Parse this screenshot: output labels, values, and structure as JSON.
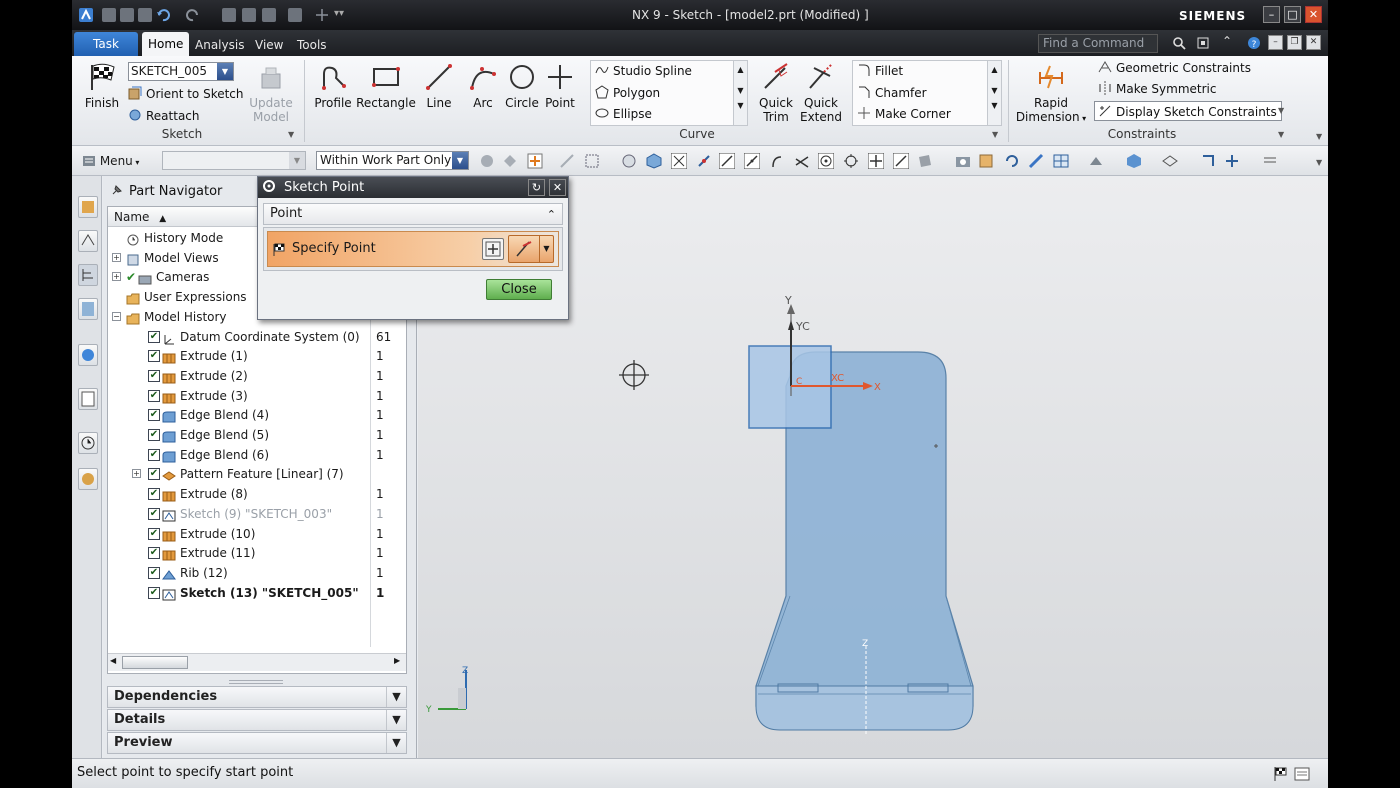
{
  "window": {
    "title": "NX 9 - Sketch - [model2.prt (Modified) ]",
    "brand": "SIEMENS"
  },
  "menu": {
    "task": "Task",
    "tabs": [
      "Home",
      "Analysis",
      "View",
      "Tools"
    ],
    "find_placeholder": "Find a Command"
  },
  "ribbon": {
    "sketch_group": {
      "finish": "Finish",
      "sketch_name": "SKETCH_005",
      "orient": "Orient to Sketch",
      "reattach": "Reattach",
      "update_model_line1": "Update",
      "update_model_line2": "Model",
      "label": "Sketch"
    },
    "curve_group": {
      "profile": "Profile",
      "rectangle": "Rectangle",
      "line": "Line",
      "arc": "Arc",
      "circle": "Circle",
      "point": "Point",
      "studio_spline": "Studio Spline",
      "polygon": "Polygon",
      "ellipse": "Ellipse",
      "quick_trim_l1": "Quick",
      "quick_trim_l2": "Trim",
      "quick_extend_l1": "Quick",
      "quick_extend_l2": "Extend",
      "fillet": "Fillet",
      "chamfer": "Chamfer",
      "make_corner": "Make Corner",
      "label": "Curve"
    },
    "constraints_group": {
      "rapid_dim_l1": "Rapid",
      "rapid_dim_l2": "Dimension",
      "geometric": "Geometric Constraints",
      "symmetric": "Make Symmetric",
      "display": "Display Sketch Constraints",
      "label": "Constraints"
    }
  },
  "toolbar": {
    "menu": "Menu",
    "filter": "Within Work Part Only"
  },
  "navigator": {
    "title": "Part Navigator",
    "column_name": "Name",
    "items": [
      {
        "label": "History Mode",
        "num": ""
      },
      {
        "label": "Model Views",
        "num": ""
      },
      {
        "label": "Cameras",
        "num": ""
      },
      {
        "label": "User Expressions",
        "num": ""
      },
      {
        "label": "Model History",
        "num": ""
      },
      {
        "label": "Datum Coordinate System (0)",
        "num": "61"
      },
      {
        "label": "Extrude (1)",
        "num": "1"
      },
      {
        "label": "Extrude (2)",
        "num": "1"
      },
      {
        "label": "Extrude (3)",
        "num": "1"
      },
      {
        "label": "Edge Blend (4)",
        "num": "1"
      },
      {
        "label": "Edge Blend (5)",
        "num": "1"
      },
      {
        "label": "Edge Blend (6)",
        "num": "1"
      },
      {
        "label": "Pattern Feature [Linear] (7)",
        "num": ""
      },
      {
        "label": "Extrude (8)",
        "num": "1"
      },
      {
        "label": "Sketch (9) \"SKETCH_003\"",
        "num": "1"
      },
      {
        "label": "Extrude (10)",
        "num": "1"
      },
      {
        "label": "Extrude (11)",
        "num": "1"
      },
      {
        "label": "Rib (12)",
        "num": "1"
      },
      {
        "label": "Sketch (13) \"SKETCH_005\"",
        "num": "1"
      }
    ],
    "accordions": [
      "Dependencies",
      "Details",
      "Preview"
    ]
  },
  "dialog": {
    "title": "Sketch Point",
    "section": "Point",
    "specify": "Specify Point",
    "close": "Close"
  },
  "graphics": {
    "axes": {
      "y": "Y",
      "yc": "YC",
      "xc": "XC",
      "x": "X",
      "z": "Z",
      "c": "C"
    },
    "triad": {
      "z": "Z",
      "y": "Y"
    }
  },
  "status": {
    "text": "Select point to specify start point"
  },
  "colors": {
    "accent_task": "#2f74c8",
    "part_fill": "#8fb3d6",
    "close_button": "#7cc46a",
    "specify_highlight": "#f3b27a"
  }
}
